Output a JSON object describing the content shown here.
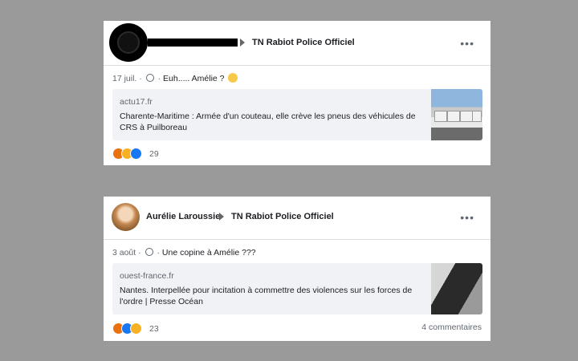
{
  "posts": [
    {
      "author_redacted": true,
      "group": "TN Rabiot Police Officiel",
      "date": "17 juil.",
      "separator": "·",
      "message": "Euh..... Amélie ?",
      "link": {
        "domain": "actu17.fr",
        "title": "Charente-Maritime : Armée d'un couteau, elle crève les pneus des véhicules de CRS à Puilboreau"
      },
      "reactions": [
        "angry",
        "haha",
        "like"
      ],
      "reaction_count": "29",
      "comments": ""
    },
    {
      "author": "Aurélie Laroussie",
      "group": "TN Rabiot Police Officiel",
      "date": "3 août",
      "separator": "·",
      "message": "Une copine à Amélie ???",
      "link": {
        "domain": "ouest-france.fr",
        "title": "Nantes. Interpellée pour incitation à commettre des violences sur les forces de l'ordre | Presse Océan"
      },
      "reactions": [
        "angry",
        "like",
        "haha"
      ],
      "reaction_count": "23",
      "comments": "4 commentaires"
    }
  ],
  "more_label": "•••"
}
